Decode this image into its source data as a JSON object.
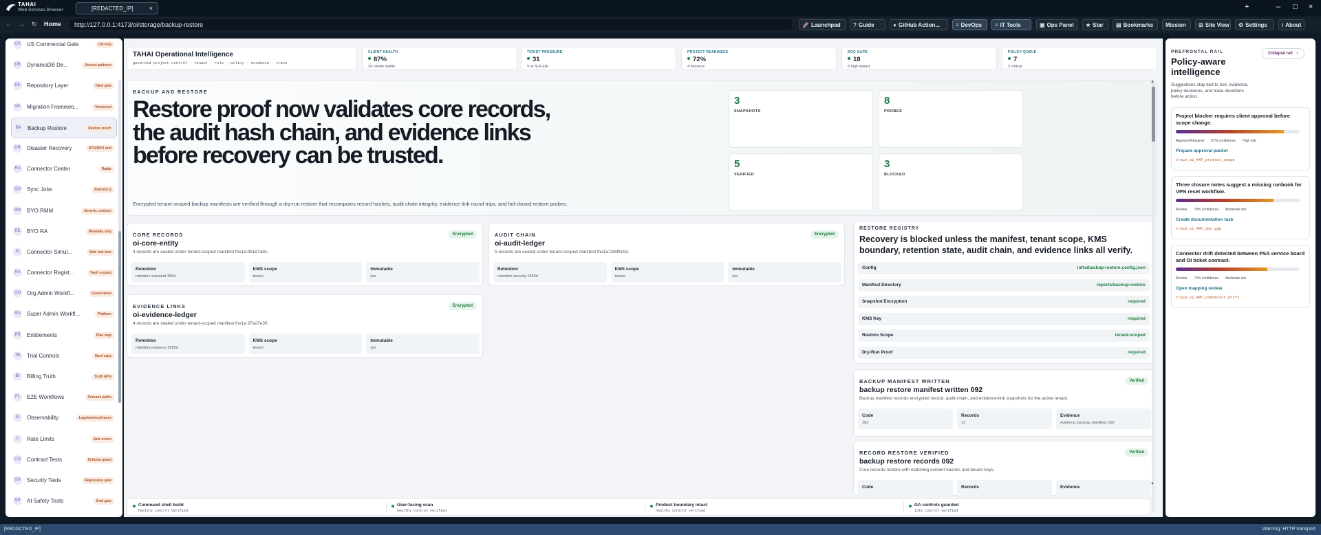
{
  "browser": {
    "brand_name": "TAHAI",
    "brand_sub": "Web Services Browser",
    "tab_title": "[REDACTED_IP]",
    "tab_close": "×",
    "new_tab": "+",
    "minimize": "–",
    "maximize": "□",
    "close": "×"
  },
  "nav": {
    "back": "←",
    "forward": "→",
    "reload": "↻",
    "home": "Home",
    "url": "http://127.0.0.1:4173/oi/storage/backup-restore"
  },
  "toolbar": [
    {
      "label": "Launchpad",
      "icon": "rocket-icon"
    },
    {
      "label": "Guide",
      "icon": "help-icon"
    },
    {
      "label": "GitHub Action...",
      "icon": "github-icon"
    },
    {
      "label": "DevOps",
      "icon": "menu-icon"
    },
    {
      "label": "IT Tools",
      "icon": "menu-icon"
    },
    {
      "label": "Ops Panel",
      "icon": "panel-icon"
    },
    {
      "label": "Star",
      "icon": "star-icon"
    },
    {
      "label": "Bookmarks",
      "icon": "bookmark-icon"
    },
    {
      "label": "Mission",
      "icon": ""
    },
    {
      "label": "Site View",
      "icon": "grid-icon"
    },
    {
      "label": "Settings",
      "icon": "gear-icon"
    },
    {
      "label": "About",
      "icon": "info-icon"
    }
  ],
  "sidebar": {
    "items": [
      {
        "ab": "US",
        "name": "US Commercial Gate",
        "badge": "US-only"
      },
      {
        "ab": "DB",
        "name": "DynamoDB De...",
        "badge": "Access patterns"
      },
      {
        "ab": "RE",
        "name": "Repository Layer",
        "badge": "Hard gate"
      },
      {
        "ab": "MI",
        "name": "Migration Framewo...",
        "badge": "Versioned"
      },
      {
        "ab": "BA",
        "name": "Backup Restore",
        "badge": "Restore proof"
      },
      {
        "ab": "DR",
        "name": "Disaster Recovery",
        "badge": "RTO/RPO drill"
      },
      {
        "ab": "RA",
        "name": "Connector Center",
        "badge": "Radar"
      },
      {
        "ab": "QU",
        "name": "Sync Jobs",
        "badge": "Retry/DLQ"
      },
      {
        "ab": "RM",
        "name": "BYO RMM",
        "badge": "Generic contract"
      },
      {
        "ab": "RE",
        "name": "BYO RA",
        "badge": "Metadata only"
      },
      {
        "ab": "SI",
        "name": "Connector Simul...",
        "badge": "Safe test lane"
      },
      {
        "ab": "RA",
        "name": "Connector Regist...",
        "badge": "Vault scoped"
      },
      {
        "ab": "GO",
        "name": "Org Admin Workfl...",
        "badge": "Governance"
      },
      {
        "ab": "SU",
        "name": "Super Admin Workfl...",
        "badge": "Platform"
      },
      {
        "ab": "PR",
        "name": "Entitlements",
        "badge": "Plan map"
      },
      {
        "ab": "TR",
        "name": "Trial Controls",
        "badge": "Hard caps"
      },
      {
        "ab": "BI",
        "name": "Billing Truth",
        "badge": "Truth APIs"
      },
      {
        "ab": "FL",
        "name": "E2E Workflows",
        "badge": "Persona paths"
      },
      {
        "ab": "SI",
        "name": "Observability",
        "badge": "Logs/metrics/traces"
      },
      {
        "ab": "LI",
        "name": "Rate Limits",
        "badge": "Safe errors"
      },
      {
        "ab": "CO",
        "name": "Contract Tests",
        "badge": "Schema guard"
      },
      {
        "ab": "SH",
        "name": "Security Tests",
        "badge": "Regression gate"
      },
      {
        "ab": "SP",
        "name": "AI Safety Tests",
        "badge": "Eval gate"
      }
    ]
  },
  "header": {
    "title": "TAHAI Operational Intelligence",
    "subtitle": "governed project control · tenant · role · policy · evidence · trace"
  },
  "metrics": [
    {
      "label": "CLIENT HEALTH",
      "value": "87%",
      "sub": "24 clients stable"
    },
    {
      "label": "TICKET PRESSURE",
      "value": "31",
      "sub": "9 at SLA risk"
    },
    {
      "label": "PROJECT READINESS",
      "value": "72%",
      "sub": "4 blockers"
    },
    {
      "label": "DOC GAPS",
      "value": "18",
      "sub": "6 high impact"
    },
    {
      "label": "POLICY QUEUE",
      "value": "7",
      "sub": "2 critical"
    }
  ],
  "hero": {
    "kicker": "BACKUP AND RESTORE",
    "title": "Restore proof now validates core records, the audit hash chain, and evidence links before recovery can be trusted.",
    "desc": "Encrypted tenant-scoped backup manifests are verified through a dry-run restore that recomputes record hashes, audit chain integrity, evidence link round trips, and fail-closed restore probes.",
    "stats": [
      {
        "n": "3",
        "l": "SNAPSHOTS"
      },
      {
        "n": "8",
        "l": "PROBES"
      },
      {
        "n": "5",
        "l": "VERIFIED"
      },
      {
        "n": "3",
        "l": "BLOCKED"
      }
    ]
  },
  "records": [
    {
      "kicker": "CORE RECORDS",
      "title": "oi-core-entity",
      "desc": "4 records are sealed under tenant-scoped manifest fnv1a:0b1d7a9c.",
      "badge": "Encrypted",
      "f1l": "Retention",
      "f1v": "retention standard 365d",
      "f2l": "KMS scope",
      "f2v": "tenant",
      "f3l": "Immutable",
      "f3v": "yes"
    },
    {
      "kicker": "AUDIT CHAIN",
      "title": "oi-audit-ledger",
      "desc": "5 records are sealed under tenant-scoped manifest fnv1a:226f6153.",
      "badge": "Encrypted",
      "f1l": "Retention",
      "f1v": "retention security 2555d",
      "f2l": "KMS scope",
      "f2v": "tenant",
      "f3l": "Immutable",
      "f3v": "yes"
    },
    {
      "kicker": "EVIDENCE LINKS",
      "title": "oi-evidence-ledger",
      "desc": "4 records are sealed under tenant-scoped manifest fnv1a:37ad7e30.",
      "badge": "Encrypted",
      "f1l": "Retention",
      "f1v": "retention evidence 2555d",
      "f2l": "KMS scope",
      "f2v": "tenant",
      "f3l": "Immutable",
      "f3v": "yes"
    }
  ],
  "registry": {
    "kicker": "RESTORE REGISTRY",
    "title": "Recovery is blocked unless the manifest, tenant scope, KMS boundary, retention state, audit chain, and evidence links all verify.",
    "rows": [
      {
        "k": "Config",
        "v": "infra/backup-restore.config.json"
      },
      {
        "k": "Manifest Directory",
        "v": "reports/backup-restore"
      },
      {
        "k": "Snapshot Encryption",
        "v": "required"
      },
      {
        "k": "KMS Key",
        "v": "required"
      },
      {
        "k": "Restore Scope",
        "v": "tenant-scoped"
      },
      {
        "k": "Dry-Run Proof",
        "v": "required"
      }
    ]
  },
  "events": [
    {
      "kicker": "BACKUP MANIFEST WRITTEN",
      "title": "backup restore manifest written 092",
      "desc": "Backup manifest records encrypted record, audit-chain, and evidence-link snapshots for the active tenant.",
      "badge": "Verified",
      "f1l": "Code",
      "f1v": "202",
      "f2l": "Records",
      "f2v": "13",
      "f3l": "Evidence",
      "f3v": "evidence_backup_manifest_092"
    },
    {
      "kicker": "RECORD RESTORE VERIFIED",
      "title": "backup restore records 092",
      "desc": "Core records restore with matching content hashes and tenant keys.",
      "badge": "Verified",
      "f1l": "Code",
      "f1v": "",
      "f2l": "Records",
      "f2v": "",
      "f3l": "Evidence",
      "f3v": ""
    }
  ],
  "footer": [
    {
      "t": "Command shell build",
      "s": "healthy control verified"
    },
    {
      "t": "User-facing scan",
      "s": "healthy control verified"
    },
    {
      "t": "Product boundary intact",
      "s": "healthy control verified"
    },
    {
      "t": "GA controls guarded",
      "s": "idle control verified"
    }
  ],
  "rail": {
    "kicker": "PREFRONTAL RAIL",
    "title": "Policy-aware intelligence",
    "desc": "Suggestions stay tied to risk, evidence, policy decisions, and trace identifiers before action.",
    "collapse": "Collapse rail",
    "chevron": "›",
    "insights": [
      {
        "title": "Project blocker requires client approval before scope change.",
        "c1": "Approval Required",
        "c2": "87% confidence",
        "c3": "High risk",
        "action": "Prepare approval packet",
        "trace": "trace_oi_AMT_project_scope",
        "fill": 0.87
      },
      {
        "title": "Three closure notes suggest a missing runbook for VPN reset workflow.",
        "c1": "Review",
        "c2": "79% confidence",
        "c3": "Moderate risk",
        "action": "Create documentation task",
        "trace": "trace_oi_AMT_doc_gap",
        "fill": 0.79
      },
      {
        "title": "Connector drift detected between PSA service board and OI ticket contract.",
        "c1": "Review",
        "c2": "74% confidence",
        "c3": "Moderate risk",
        "action": "Open mapping review",
        "trace": "trace_oi_AMT_connector_drift",
        "fill": 0.74
      }
    ]
  },
  "statusbar": {
    "left": "[REDACTED_IP]",
    "right": "Warning: HTTP transport"
  },
  "colors": {
    "accent_green": "#1a7a4a",
    "accent_teal": "#1f6f86",
    "badge_orange": "#a4532b",
    "status_blue": "#2d4a6e"
  }
}
